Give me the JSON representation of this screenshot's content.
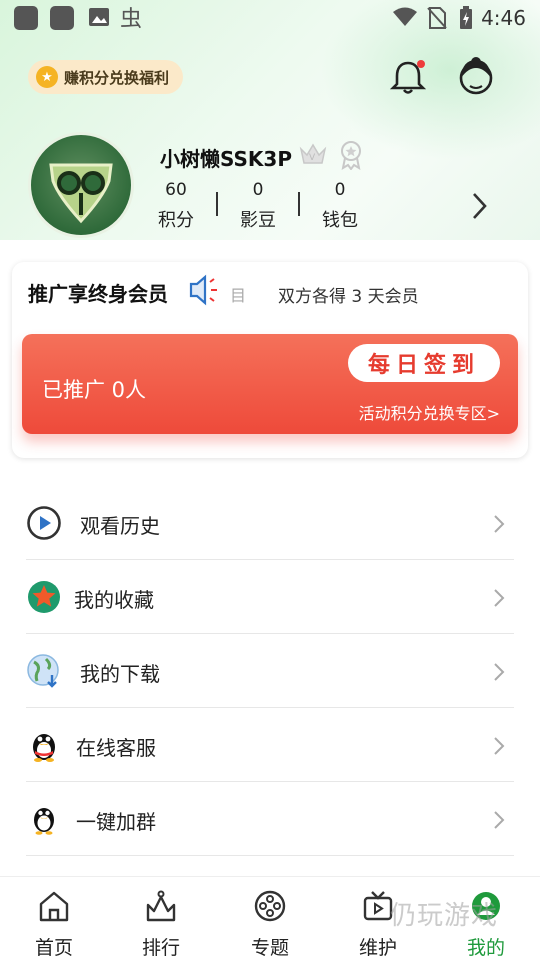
{
  "status_bar": {
    "time": "4:46",
    "left_icons": [
      "app-icon",
      "app-icon",
      "image-icon",
      "bug-icon"
    ],
    "right_icons": [
      "wifi-icon",
      "sim-off-icon",
      "battery-charging-icon"
    ]
  },
  "header": {
    "points_pill_label": "赚积分兑换福利",
    "bell_has_dot": true
  },
  "profile": {
    "nickname": "小树懒SSK3P",
    "stats": [
      {
        "value": "60",
        "label": "积分"
      },
      {
        "value": "0",
        "label": "影豆"
      },
      {
        "value": "0",
        "label": "钱包"
      }
    ]
  },
  "promo": {
    "title": "推广享终身会员",
    "scroll_fragment": "目",
    "message": "双方各得 3 天会员",
    "promoted_text": "已推广 0人",
    "signin_label": "每日签到",
    "exchange_link": "活动积分兑换专区>"
  },
  "menu": {
    "items": [
      {
        "label": "观看历史",
        "icon": "play-circle-icon"
      },
      {
        "label": "我的收藏",
        "icon": "star-badge-icon"
      },
      {
        "label": "我的下载",
        "icon": "globe-download-icon"
      },
      {
        "label": "在线客服",
        "icon": "qq-penguin-icon"
      },
      {
        "label": "一键加群",
        "icon": "qq-penguin-icon"
      }
    ]
  },
  "bottom_nav": {
    "items": [
      {
        "label": "首页",
        "icon": "home-icon"
      },
      {
        "label": "排行",
        "icon": "ranking-icon"
      },
      {
        "label": "专题",
        "icon": "film-reel-icon"
      },
      {
        "label": "维护",
        "icon": "tv-icon"
      },
      {
        "label": "我的",
        "icon": "profile-icon",
        "active": true
      }
    ],
    "active_color": "#1f9a3c"
  },
  "watermark": "仍玩游戏",
  "colors": {
    "accent_red": "#ee4a3a",
    "accent_green": "#1f9a3c",
    "pill_bg": "#fbe9c9"
  }
}
